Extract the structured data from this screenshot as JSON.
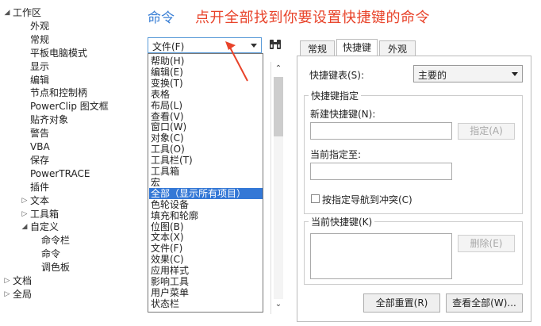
{
  "tree": {
    "items": [
      {
        "label": "工作区",
        "indent": 0,
        "arrow": "▲"
      },
      {
        "label": "外观",
        "indent": 1
      },
      {
        "label": "常规",
        "indent": 1
      },
      {
        "label": "平板电脑模式",
        "indent": 1
      },
      {
        "label": "显示",
        "indent": 1
      },
      {
        "label": "编辑",
        "indent": 1
      },
      {
        "label": "节点和控制柄",
        "indent": 1
      },
      {
        "label": "PowerClip 图文框",
        "indent": 1
      },
      {
        "label": "贴齐对象",
        "indent": 1
      },
      {
        "label": "警告",
        "indent": 1
      },
      {
        "label": "VBA",
        "indent": 1
      },
      {
        "label": "保存",
        "indent": 1
      },
      {
        "label": "PowerTRACE",
        "indent": 1
      },
      {
        "label": "插件",
        "indent": 1
      },
      {
        "label": "文本",
        "indent": 1,
        "arrow": "▷"
      },
      {
        "label": "工具箱",
        "indent": 1,
        "arrow": "▷"
      },
      {
        "label": "自定义",
        "indent": 1,
        "arrow": "▲"
      },
      {
        "label": "命令栏",
        "indent": 2
      },
      {
        "label": "命令",
        "indent": 2
      },
      {
        "label": "调色板",
        "indent": 2
      },
      {
        "label": "文档",
        "indent": 0,
        "arrow": "▷"
      },
      {
        "label": "全局",
        "indent": 0,
        "arrow": "▷"
      }
    ]
  },
  "heading": "命令",
  "annotation": "点开全部找到你要设置快捷键的命令",
  "combo": {
    "value": "文件(F)"
  },
  "menu": {
    "items": [
      "帮助(H)",
      "编辑(E)",
      "变换(T)",
      "表格",
      "布局(L)",
      "查看(V)",
      "窗口(W)",
      "对象(C)",
      "工具(O)",
      "工具栏(T)",
      "工具箱",
      "宏",
      "全部（显示所有项目）",
      "色轮设备",
      "填充和轮廓",
      "位图(B)",
      "文本(X)",
      "文件(F)",
      "效果(C)",
      "应用样式",
      "影响工具",
      "用户菜单",
      "状态栏"
    ],
    "highlighted": "全部（显示所有项目）"
  },
  "tabs": [
    "常规",
    "快捷键",
    "外观"
  ],
  "active_tab": "快捷键",
  "shortcut_table": {
    "label": "快捷键表(S):",
    "value": "主要的"
  },
  "assign_group": {
    "title": "快捷键指定",
    "new_label": "新建快捷键(N):",
    "assign_button": "指定(A)",
    "current_label": "当前指定至:",
    "nav_checkbox": "按指定导航到冲突(C)"
  },
  "current_group": {
    "title": "当前快捷键(K)",
    "delete_button": "删除(E)"
  },
  "buttons": {
    "reset_all": "全部重置(R)",
    "view_all": "查看全部(W)..."
  },
  "colors": {
    "accent": "#3a7fd5",
    "annotation": "#e8432a",
    "highlight": "#3478d6"
  }
}
